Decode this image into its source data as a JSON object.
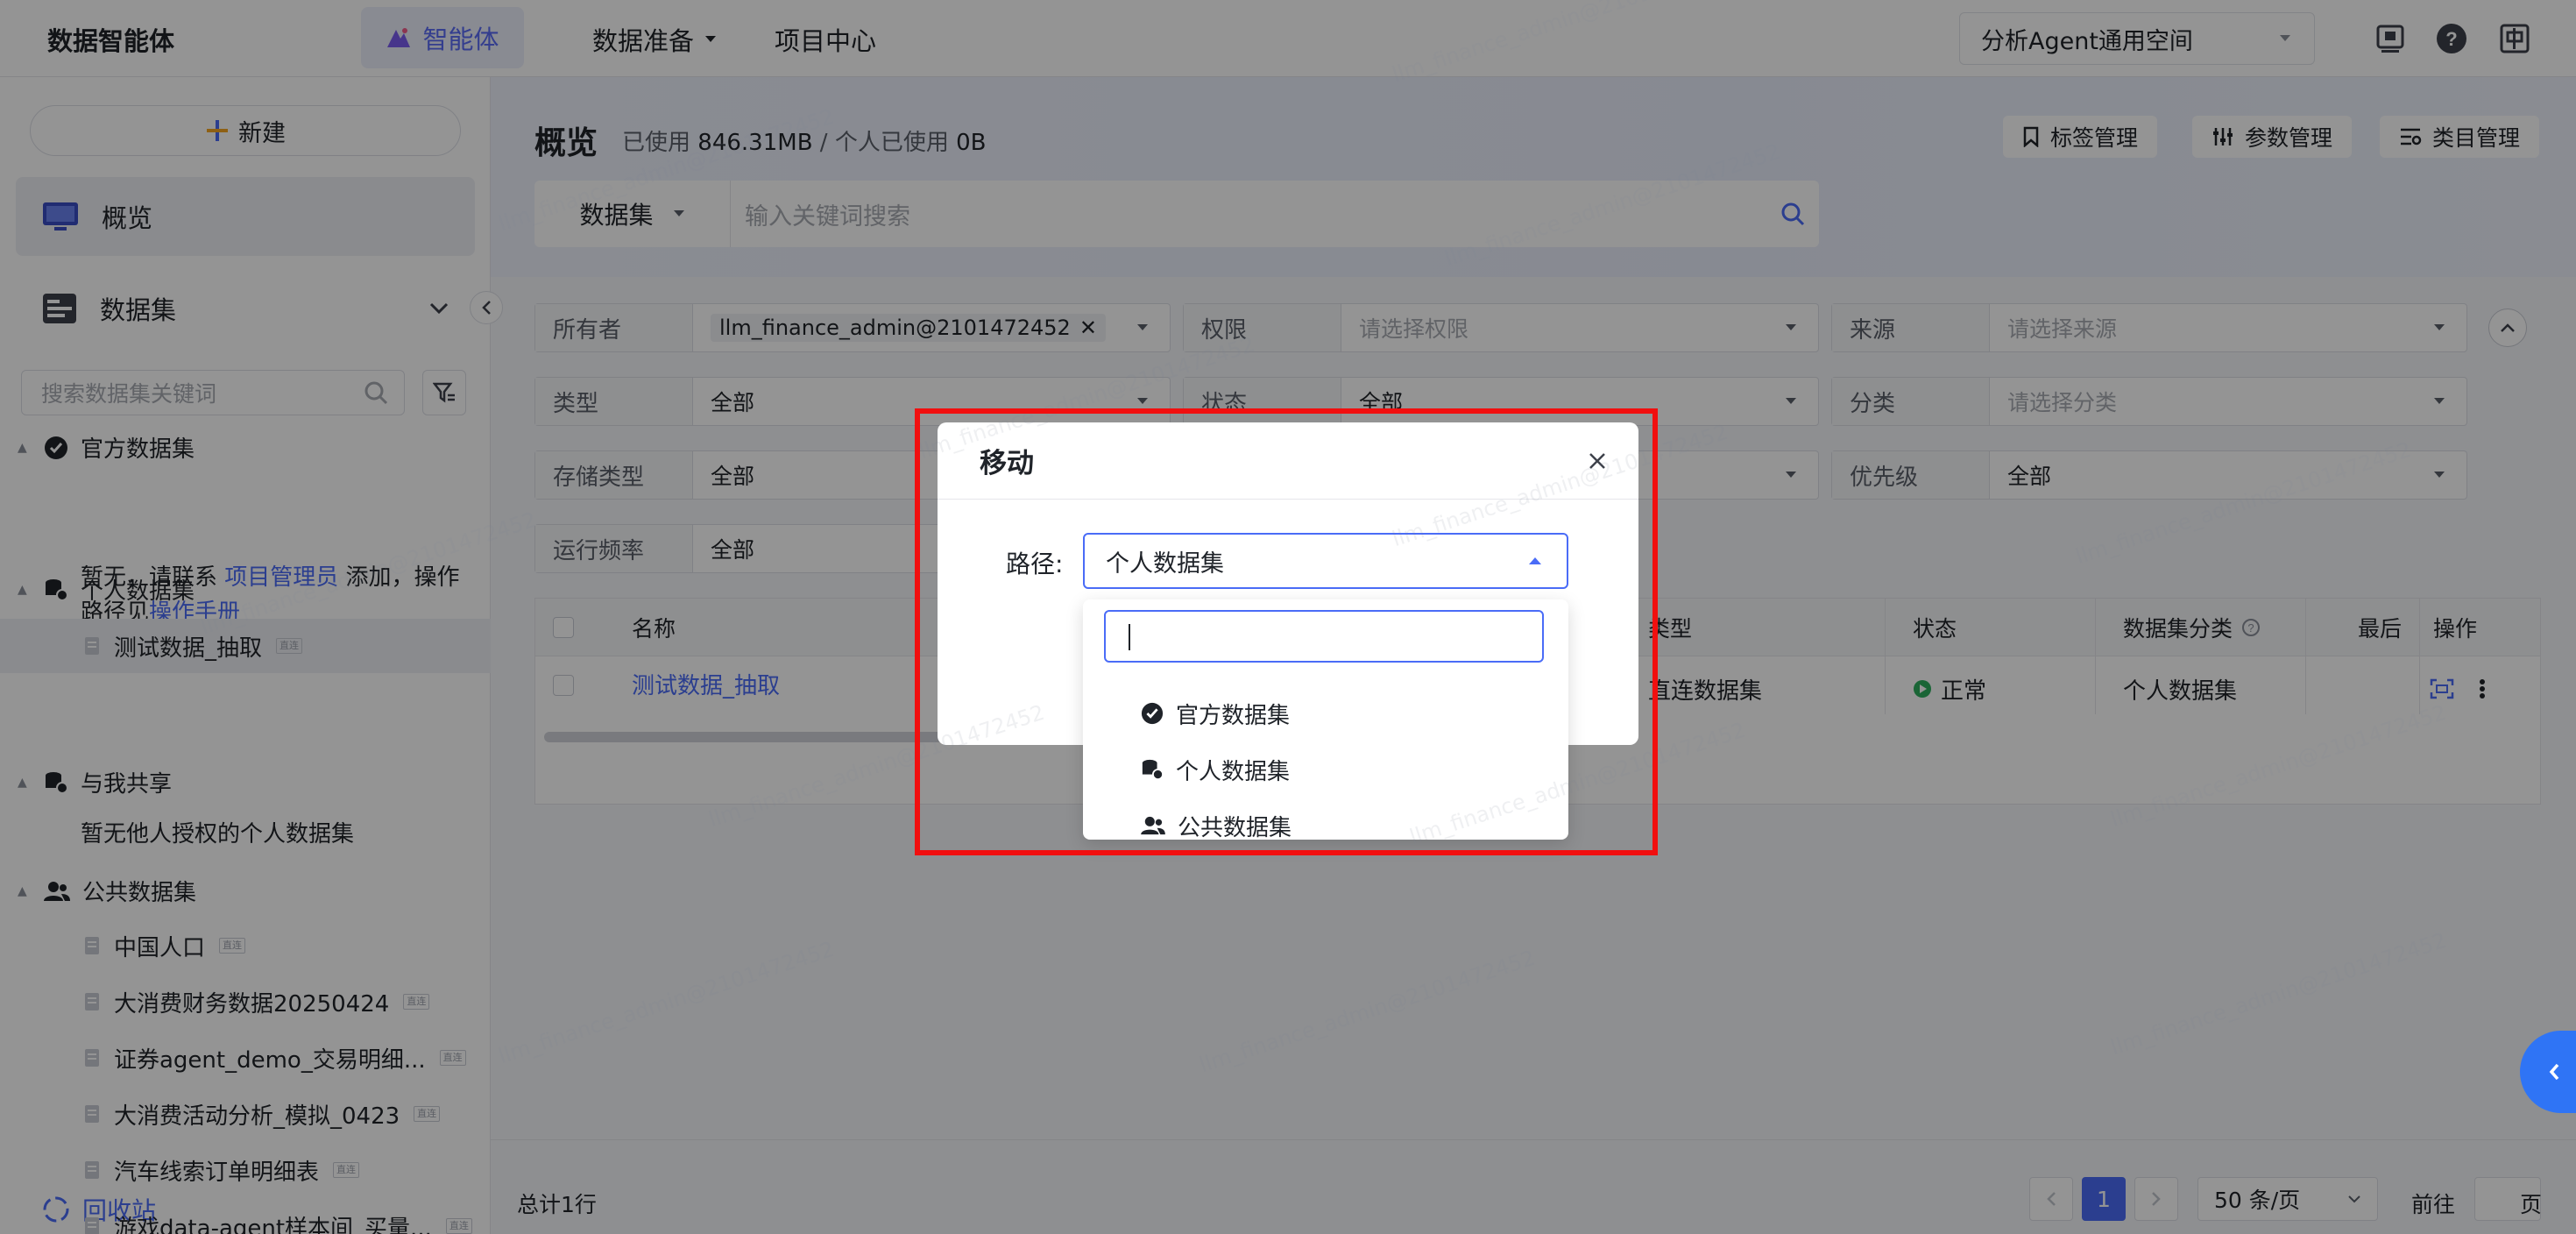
{
  "topbar": {
    "logo": "数据智能体",
    "nav": {
      "agent": "智能体",
      "prep": "数据准备",
      "project": "项目中心"
    },
    "workspace": "分析Agent通用空间"
  },
  "sidebar": {
    "new_label": "新建",
    "overview": "概览",
    "datasets": "数据集",
    "search_placeholder": "搜索数据集关键词",
    "groups": {
      "official": "官方数据集",
      "official_note_pre": "暂无，请联系 ",
      "official_note_link1": "项目管理员",
      "official_note_mid": " 添加，操作路径见",
      "official_note_link2": "操作手册",
      "personal": "个人数据集",
      "shared": "与我共享",
      "shared_note": "暂无他人授权的个人数据集",
      "public": "公共数据集"
    },
    "personal_items": [
      {
        "label": "测试数据_抽取",
        "tag": "直连"
      }
    ],
    "public_items": [
      {
        "label": "中国人口",
        "tag": "直连"
      },
      {
        "label": "大消费财务数据20250424",
        "tag": "直连"
      },
      {
        "label": "证券agent_demo_交易明细...",
        "tag": "直连"
      },
      {
        "label": "大消费活动分析_模拟_0423",
        "tag": "直连"
      },
      {
        "label": "汽车线索订单明细表",
        "tag": "直连"
      },
      {
        "label": "游戏data-agent样本间_买量...",
        "tag": "直连"
      }
    ],
    "recycle": "回收站"
  },
  "main": {
    "title": "概览",
    "usage_pre": "已使用",
    "usage_total": "846.31MB",
    "usage_sep": " / ",
    "usage_personal_label": "个人已使用",
    "usage_personal": "0B",
    "buttons": {
      "tags": "标签管理",
      "params": "参数管理",
      "categories": "类目管理"
    },
    "search_type": "数据集",
    "search_placeholder": "输入关键词搜索"
  },
  "filters": {
    "owner_label": "所有者",
    "owner_value": "llm_finance_admin@2101472452",
    "perm_label": "权限",
    "perm_placeholder": "请选择权限",
    "source_label": "来源",
    "source_placeholder": "请选择来源",
    "type_label": "类型",
    "type_value": "全部",
    "status_label": "状态",
    "status_value": "全部",
    "category_label": "分类",
    "category_placeholder": "请选择分类",
    "storage_label": "存储类型",
    "storage_value": "全部",
    "priority_label": "优先级",
    "priority_value": "全部",
    "freq_label": "运行频率",
    "freq_value": "全部"
  },
  "table": {
    "headers": {
      "name": "名称",
      "type": "类型",
      "status": "状态",
      "category": "数据集分类",
      "last": "最后",
      "ops": "操作"
    },
    "rows": [
      {
        "name": "测试数据_抽取",
        "type": "直连数据集",
        "status": "正常",
        "category": "个人数据集"
      }
    ]
  },
  "footer": {
    "total": "总计1行",
    "page": "1",
    "page_size": "50 条/页",
    "goto": "前往",
    "page_unit": "页"
  },
  "dialog": {
    "title": "移动",
    "path_label": "路径:",
    "path_value": "个人数据集",
    "options": [
      "官方数据集",
      "个人数据集",
      "公共数据集"
    ]
  },
  "watermark": "llm_finance_admin@2101472452",
  "colors": {
    "accent": "#4a6cf7",
    "highlight": "#f10f0f",
    "status_ok": "#2eaf5d"
  }
}
